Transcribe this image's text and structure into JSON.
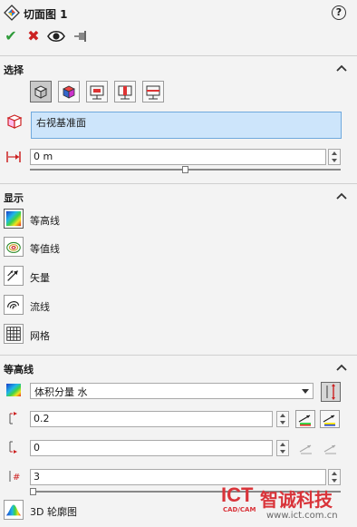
{
  "header": {
    "title": "切面图 1",
    "help_label": "?"
  },
  "actions": {
    "ok_symbol": "✔",
    "cancel_symbol": "✖"
  },
  "selection": {
    "section_title": "选择",
    "tool_buttons": [
      "plane-box",
      "plane-color-cube",
      "plane-section-a",
      "plane-section-b",
      "plane-section-c"
    ],
    "active_tool_index": 0,
    "face_value": "右视基准面",
    "offset_value": "0 m",
    "offset_slider_fraction": 0.5
  },
  "display": {
    "section_title": "显示",
    "items": [
      {
        "label": "等高线",
        "icon": "contour-icon",
        "active": true
      },
      {
        "label": "等值线",
        "icon": "isoline-icon",
        "active": false
      },
      {
        "label": "矢量",
        "icon": "vector-icon",
        "active": false
      },
      {
        "label": "流线",
        "icon": "streamline-icon",
        "active": false
      },
      {
        "label": "网格",
        "icon": "mesh-icon",
        "active": false
      }
    ]
  },
  "contour": {
    "section_title": "等高线",
    "parameter_value": "体积分量 水",
    "max_value": "0.2",
    "min_value": "0",
    "levels_value": "3",
    "levels_slider_fraction": 0.0,
    "profile_label": "3D 轮廓图"
  },
  "watermark": {
    "brand": "ICT",
    "sub": "CAD/CAM",
    "name": "智诚科技",
    "url": "www.ict.com.cn"
  },
  "colors": {
    "accent_blue": "#cde5fb",
    "ok_green": "#2f9b3a",
    "cancel_red": "#cc2222",
    "watermark_red": "#d9343a"
  }
}
